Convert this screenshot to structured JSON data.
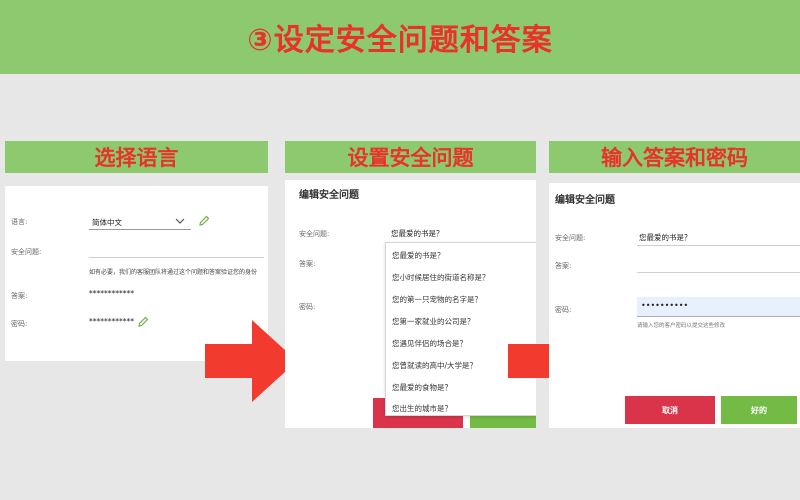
{
  "banner": {
    "title": "③设定安全问题和答案"
  },
  "steps": [
    {
      "label": "选择语言"
    },
    {
      "label": "设置安全问题"
    },
    {
      "label": "输入答案和密码"
    }
  ],
  "panel1": {
    "language_label": "语言:",
    "language_value": "简体中文",
    "question_label": "安全问题:",
    "notice": "如有必要，我们的客服团队将通过这个问题和答案验证您的身份",
    "answer_label": "答案:",
    "answer_value": "************",
    "password_label": "密码:",
    "password_value": "************"
  },
  "panel2": {
    "title": "编辑安全问题",
    "question_label": "安全问题:",
    "question_value": "您最爱的书是？",
    "answer_label": "答案:",
    "password_label": "密码:",
    "options": [
      "您最爱的书是？",
      "您小时候居住的街道名称是？",
      "您的第一只宠物的名字是？",
      "您第一家就业的公司是？",
      "您遇见伴侣的场合是？",
      "您曾就读的高中/大学是？",
      "您最爱的食物是？",
      "您出生的城市是？"
    ]
  },
  "panel3": {
    "title": "编辑安全问题",
    "question_label": "安全问题:",
    "question_value": "您最爱的书是？",
    "answer_label": "答案:",
    "password_label": "密码:",
    "password_value": "••••••••••",
    "password_hint": "请输入您的客户密码以提交这些修改",
    "cancel_label": "取消",
    "ok_label": "好的"
  },
  "colors": {
    "banner_bg": "#8dc96f",
    "title_red": "#e8322a",
    "arrow_red": "#f23a2f",
    "cancel_red": "#d9344a",
    "ok_green": "#73bb45"
  }
}
